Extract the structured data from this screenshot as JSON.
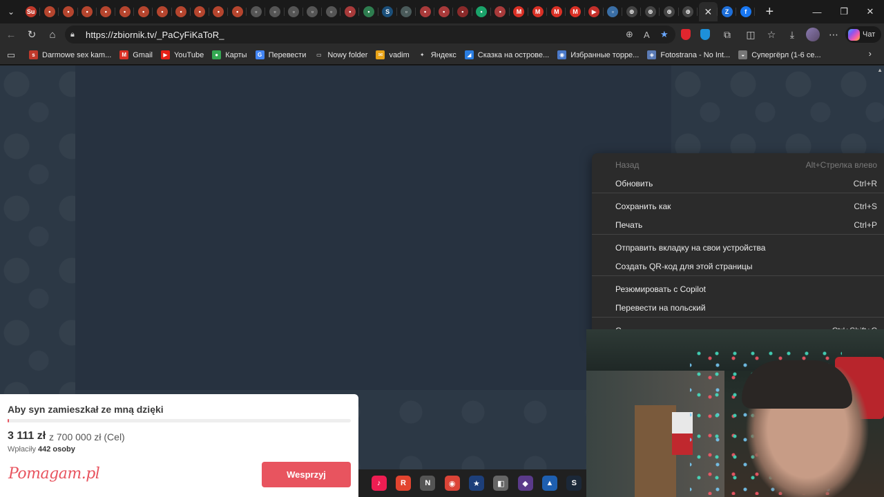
{
  "browser": {
    "tabs": [
      {
        "name": "tab-1",
        "icon": "sh-favicon",
        "color": "#c0392b",
        "glyph": "Su"
      },
      {
        "name": "tab-2",
        "icon": "red-favicon",
        "color": "#b5452e",
        "glyph": "•"
      },
      {
        "name": "tab-3",
        "icon": "red-favicon",
        "color": "#b5452e",
        "glyph": "•"
      },
      {
        "name": "tab-4",
        "icon": "red-favicon",
        "color": "#b5452e",
        "glyph": "•"
      },
      {
        "name": "tab-5",
        "icon": "red-favicon",
        "color": "#b5452e",
        "glyph": "•"
      },
      {
        "name": "tab-6",
        "icon": "red-favicon",
        "color": "#b5452e",
        "glyph": "•"
      },
      {
        "name": "tab-7",
        "icon": "red-favicon",
        "color": "#b5452e",
        "glyph": "•"
      },
      {
        "name": "tab-8",
        "icon": "red-favicon",
        "color": "#b5452e",
        "glyph": "•"
      },
      {
        "name": "tab-9",
        "icon": "red-favicon",
        "color": "#b5452e",
        "glyph": "•"
      },
      {
        "name": "tab-10",
        "icon": "red-favicon",
        "color": "#b5452e",
        "glyph": "•"
      },
      {
        "name": "tab-11",
        "icon": "red-favicon",
        "color": "#b5452e",
        "glyph": "•"
      },
      {
        "name": "tab-12",
        "icon": "red-favicon",
        "color": "#b5452e",
        "glyph": "•"
      },
      {
        "name": "tab-13",
        "icon": "grey-favicon",
        "color": "#555",
        "glyph": "▫"
      },
      {
        "name": "tab-14",
        "icon": "grey-favicon",
        "color": "#555",
        "glyph": "▫"
      },
      {
        "name": "tab-15",
        "icon": "grey-favicon",
        "color": "#555",
        "glyph": "▫"
      },
      {
        "name": "tab-16",
        "icon": "grey-favicon",
        "color": "#555",
        "glyph": "▫"
      },
      {
        "name": "tab-17",
        "icon": "grey-favicon",
        "color": "#555",
        "glyph": "▫"
      },
      {
        "name": "tab-18",
        "icon": "red-favicon",
        "color": "#a83a3a",
        "glyph": "•"
      },
      {
        "name": "tab-19",
        "icon": "green-favicon",
        "color": "#2e7d4f",
        "glyph": "•"
      },
      {
        "name": "tab-20",
        "icon": "steam-icon",
        "color": "#1b4f7a",
        "glyph": "S"
      },
      {
        "name": "tab-21",
        "icon": "grey-favicon",
        "color": "#4a5a5a",
        "glyph": "▫"
      },
      {
        "name": "tab-22",
        "icon": "red-favicon",
        "color": "#a83a3a",
        "glyph": "•"
      },
      {
        "name": "tab-23",
        "icon": "red-favicon",
        "color": "#a83a3a",
        "glyph": "•"
      },
      {
        "name": "tab-24",
        "icon": "red-favicon",
        "color": "#8a2a2a",
        "glyph": "▪"
      },
      {
        "name": "tab-25",
        "icon": "green-favicon",
        "color": "#1aa36a",
        "glyph": "•"
      },
      {
        "name": "tab-26",
        "icon": "red-favicon",
        "color": "#a83a3a",
        "glyph": "•"
      },
      {
        "name": "tab-27",
        "icon": "gmail-icon",
        "color": "#d93025",
        "glyph": "M"
      },
      {
        "name": "tab-28",
        "icon": "gmail-icon",
        "color": "#d93025",
        "glyph": "M"
      },
      {
        "name": "tab-29",
        "icon": "gmail-icon",
        "color": "#d93025",
        "glyph": "M"
      },
      {
        "name": "tab-30",
        "icon": "gmail-icon",
        "color": "#d93025",
        "glyph": "M"
      },
      {
        "name": "tab-31",
        "icon": "youtube-icon",
        "color": "#c4302b",
        "glyph": "▶"
      },
      {
        "name": "tab-32",
        "icon": "blue-favicon",
        "color": "#3a6ea5",
        "glyph": "▫"
      },
      {
        "name": "tab-33",
        "icon": "globe-icon",
        "color": "#444",
        "glyph": "⊕"
      },
      {
        "name": "tab-34",
        "icon": "globe-icon",
        "color": "#444",
        "glyph": "⊕"
      },
      {
        "name": "tab-35",
        "icon": "globe-icon",
        "color": "#444",
        "glyph": "⊕"
      },
      {
        "name": "tab-36",
        "icon": "globe-icon",
        "color": "#444",
        "glyph": "⊕"
      }
    ],
    "active_tab_close": "✕",
    "after_tabs": [
      {
        "name": "tab-zbiornik",
        "icon": "zbiornik-icon",
        "color": "#1e6fd9",
        "glyph": "Z"
      },
      {
        "name": "tab-facebook",
        "icon": "facebook-icon",
        "color": "#1877f2",
        "glyph": "f"
      }
    ],
    "new_tab": "+",
    "window": {
      "minimize": "—",
      "restore": "❐",
      "close": "✕"
    },
    "url": "https://zbiornik.tv/_PaCyFiKaToR_",
    "chat_label": "Чат"
  },
  "bookmarks": [
    {
      "label": "Darmowe sex kam...",
      "icon": "sh-favicon",
      "color": "#c0392b",
      "glyph": "s"
    },
    {
      "label": "Gmail",
      "icon": "gmail-icon",
      "color": "#d93025",
      "glyph": "M"
    },
    {
      "label": "YouTube",
      "icon": "youtube-icon",
      "color": "#e62117",
      "glyph": "▶"
    },
    {
      "label": "Карты",
      "icon": "maps-pin-icon",
      "color": "#34a853",
      "glyph": "●"
    },
    {
      "label": "Перевести",
      "icon": "translate-icon",
      "color": "#4285f4",
      "glyph": "G"
    },
    {
      "label": "Nowy folder",
      "icon": "folder-icon",
      "color": "transparent",
      "glyph": "▭"
    },
    {
      "label": "vadim",
      "icon": "mail-icon",
      "color": "#e8a317",
      "glyph": "✉"
    },
    {
      "label": "Яндекс",
      "icon": "sparkle-icon",
      "color": "transparent",
      "glyph": "✦"
    },
    {
      "label": "Сказка на острове...",
      "icon": "bird-icon",
      "color": "#2a7de1",
      "glyph": "◢"
    },
    {
      "label": "Избранные торре...",
      "icon": "torrent-icon",
      "color": "#4a79c9",
      "glyph": "◉"
    },
    {
      "label": "Fotostrana - No Int...",
      "icon": "fotostrana-icon",
      "color": "#5b7bb5",
      "glyph": "◈"
    },
    {
      "label": "Супергёрл (1-6 се...",
      "icon": "cap-icon",
      "color": "#777",
      "glyph": "◒"
    }
  ],
  "context_menu": {
    "items": [
      {
        "name": "menu-back",
        "label": "Назад",
        "shortcut": "Alt+Стрелка влево",
        "disabled": true
      },
      {
        "name": "menu-reload",
        "label": "Обновить",
        "shortcut": "Ctrl+R",
        "disabled": false
      },
      {
        "name": "menu-save-as",
        "label": "Сохранить как",
        "shortcut": "Ctrl+S",
        "disabled": false
      },
      {
        "name": "menu-print",
        "label": "Печать",
        "shortcut": "Ctrl+P",
        "disabled": false
      },
      {
        "name": "menu-send-tab",
        "label": "Отправить вкладку на свои устройства",
        "shortcut": "",
        "disabled": false
      },
      {
        "name": "menu-qr-code",
        "label": "Создать QR-код для этой страницы",
        "shortcut": "",
        "disabled": false
      },
      {
        "name": "menu-copilot",
        "label": "Резюмировать с Copilot",
        "shortcut": "",
        "disabled": false
      },
      {
        "name": "menu-translate",
        "label": "Перевести на польский",
        "shortcut": "",
        "disabled": false
      },
      {
        "name": "menu-partial",
        "label": "С...",
        "shortcut": "Ctrl+Shift+C",
        "disabled": false
      }
    ]
  },
  "fundraiser": {
    "title": "Aby syn zamieszkał ze mną dzięki",
    "amount": "3 111 zł",
    "goal": "z 700 000 zł (Cel)",
    "payers_prefix": "Wpłaciły",
    "payers_count": "442 osoby",
    "progress_fraction": 0.0044,
    "logo": "Pomagam.pl",
    "button": "Wesprzyj",
    "accent": "#e8545f"
  },
  "taskbar": [
    {
      "name": "tiktok-icon",
      "color": "#111",
      "glyph": "♪",
      "bg": "#ee1d52"
    },
    {
      "name": "red-app-icon",
      "color": "#e2442f",
      "glyph": "R",
      "bg": "#e2442f"
    },
    {
      "name": "n-app-icon",
      "color": "#ddd",
      "glyph": "N",
      "bg": "#555"
    },
    {
      "name": "chrome-icon",
      "color": "#4285f4",
      "glyph": "◉",
      "bg": "#db4437"
    },
    {
      "name": "star-app-icon",
      "color": "#2a5fa8",
      "glyph": "★",
      "bg": "#1d3f7a"
    },
    {
      "name": "box-app-icon",
      "color": "#888",
      "glyph": "◧",
      "bg": "#666"
    },
    {
      "name": "puzzle-app-icon",
      "color": "#7a5aa8",
      "glyph": "◆",
      "bg": "#5a3a8a"
    },
    {
      "name": "photos-app-icon",
      "color": "#2a7de1",
      "glyph": "▲",
      "bg": "#1e5fb0"
    },
    {
      "name": "steam-taskbar-icon",
      "color": "#1b4f7a",
      "glyph": "S",
      "bg": "#1b2838"
    }
  ]
}
